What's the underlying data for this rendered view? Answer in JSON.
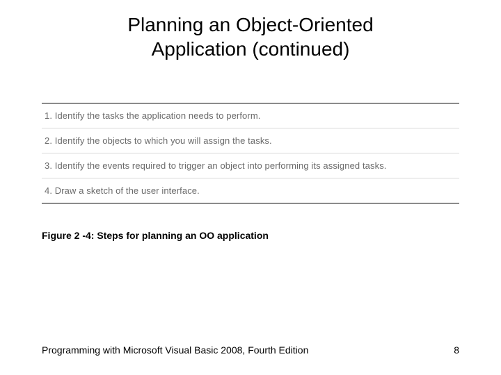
{
  "title_line1": "Planning an Object-Oriented",
  "title_line2": "Application (continued)",
  "steps": [
    "1. Identify the tasks the application needs to perform.",
    "2. Identify the objects to which you will assign the tasks.",
    "3. Identify the events required to trigger an object into performing its assigned tasks.",
    "4. Draw a sketch of the user interface."
  ],
  "caption": "Figure 2 -4: Steps for planning an OO application",
  "footer_text": "Programming with Microsoft Visual Basic 2008, Fourth Edition",
  "page_number": "8"
}
